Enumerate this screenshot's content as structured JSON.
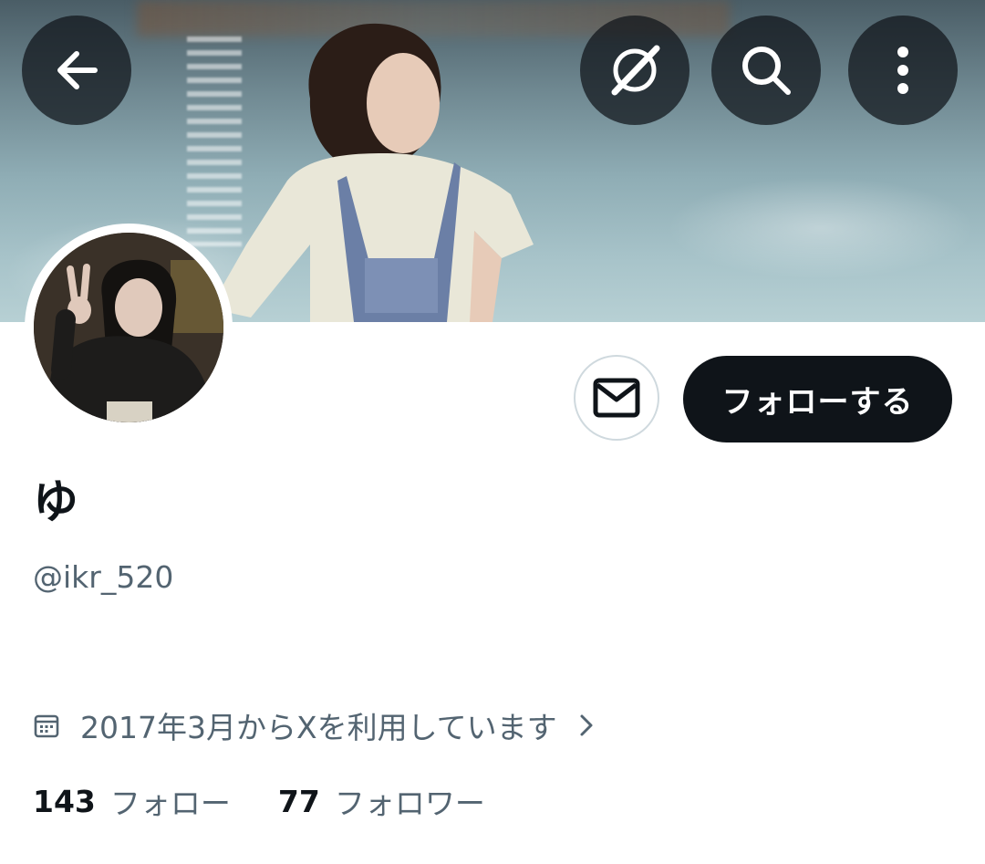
{
  "header": {
    "back_icon": "arrow-left-icon",
    "grok_icon": "grok-icon",
    "search_icon": "search-icon",
    "more_icon": "more-vertical-icon"
  },
  "profile": {
    "display_name": "ゆ",
    "handle": "@ikr_520",
    "joined": "2017年3月からXを利用しています",
    "following_count": "143",
    "following_label": "フォロー",
    "followers_count": "77",
    "followers_label": "フォロワー"
  },
  "actions": {
    "message_icon": "mail-icon",
    "follow_label": "フォローする"
  },
  "colors": {
    "primary_text": "#0f1419",
    "secondary_text": "#536471",
    "button_dark": "#0f1419",
    "border": "#cfd9de"
  }
}
